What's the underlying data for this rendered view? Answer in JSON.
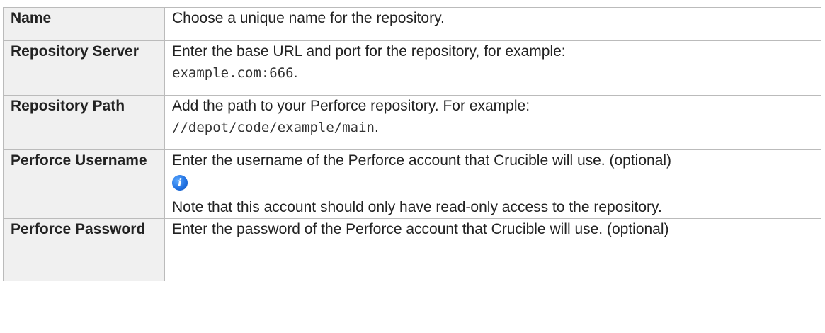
{
  "rows": [
    {
      "key": "Name",
      "text": "Choose a unique name for the repository."
    },
    {
      "key": "Repository Server",
      "text": "Enter the base URL and port for the repository, for example:",
      "code": "example.com:666",
      "suffix": "."
    },
    {
      "key": "Repository Path",
      "text": "Add the path to your Perforce repository. For example:",
      "code": "//depot/code/example/main",
      "suffix": "."
    },
    {
      "key": "Perforce Username",
      "text": "Enter the username of the Perforce account that Crucible will use. (optional)",
      "icon": "info-icon",
      "note": "Note that this account should only have read-only access to the repository."
    },
    {
      "key": "Perforce Password",
      "text": "Enter the password of the Perforce account that Crucible will use. (optional)"
    }
  ],
  "colors": {
    "key_background": "#f0f0f0",
    "border": "#bbbbbb",
    "info_icon": "#1f6fe0"
  }
}
